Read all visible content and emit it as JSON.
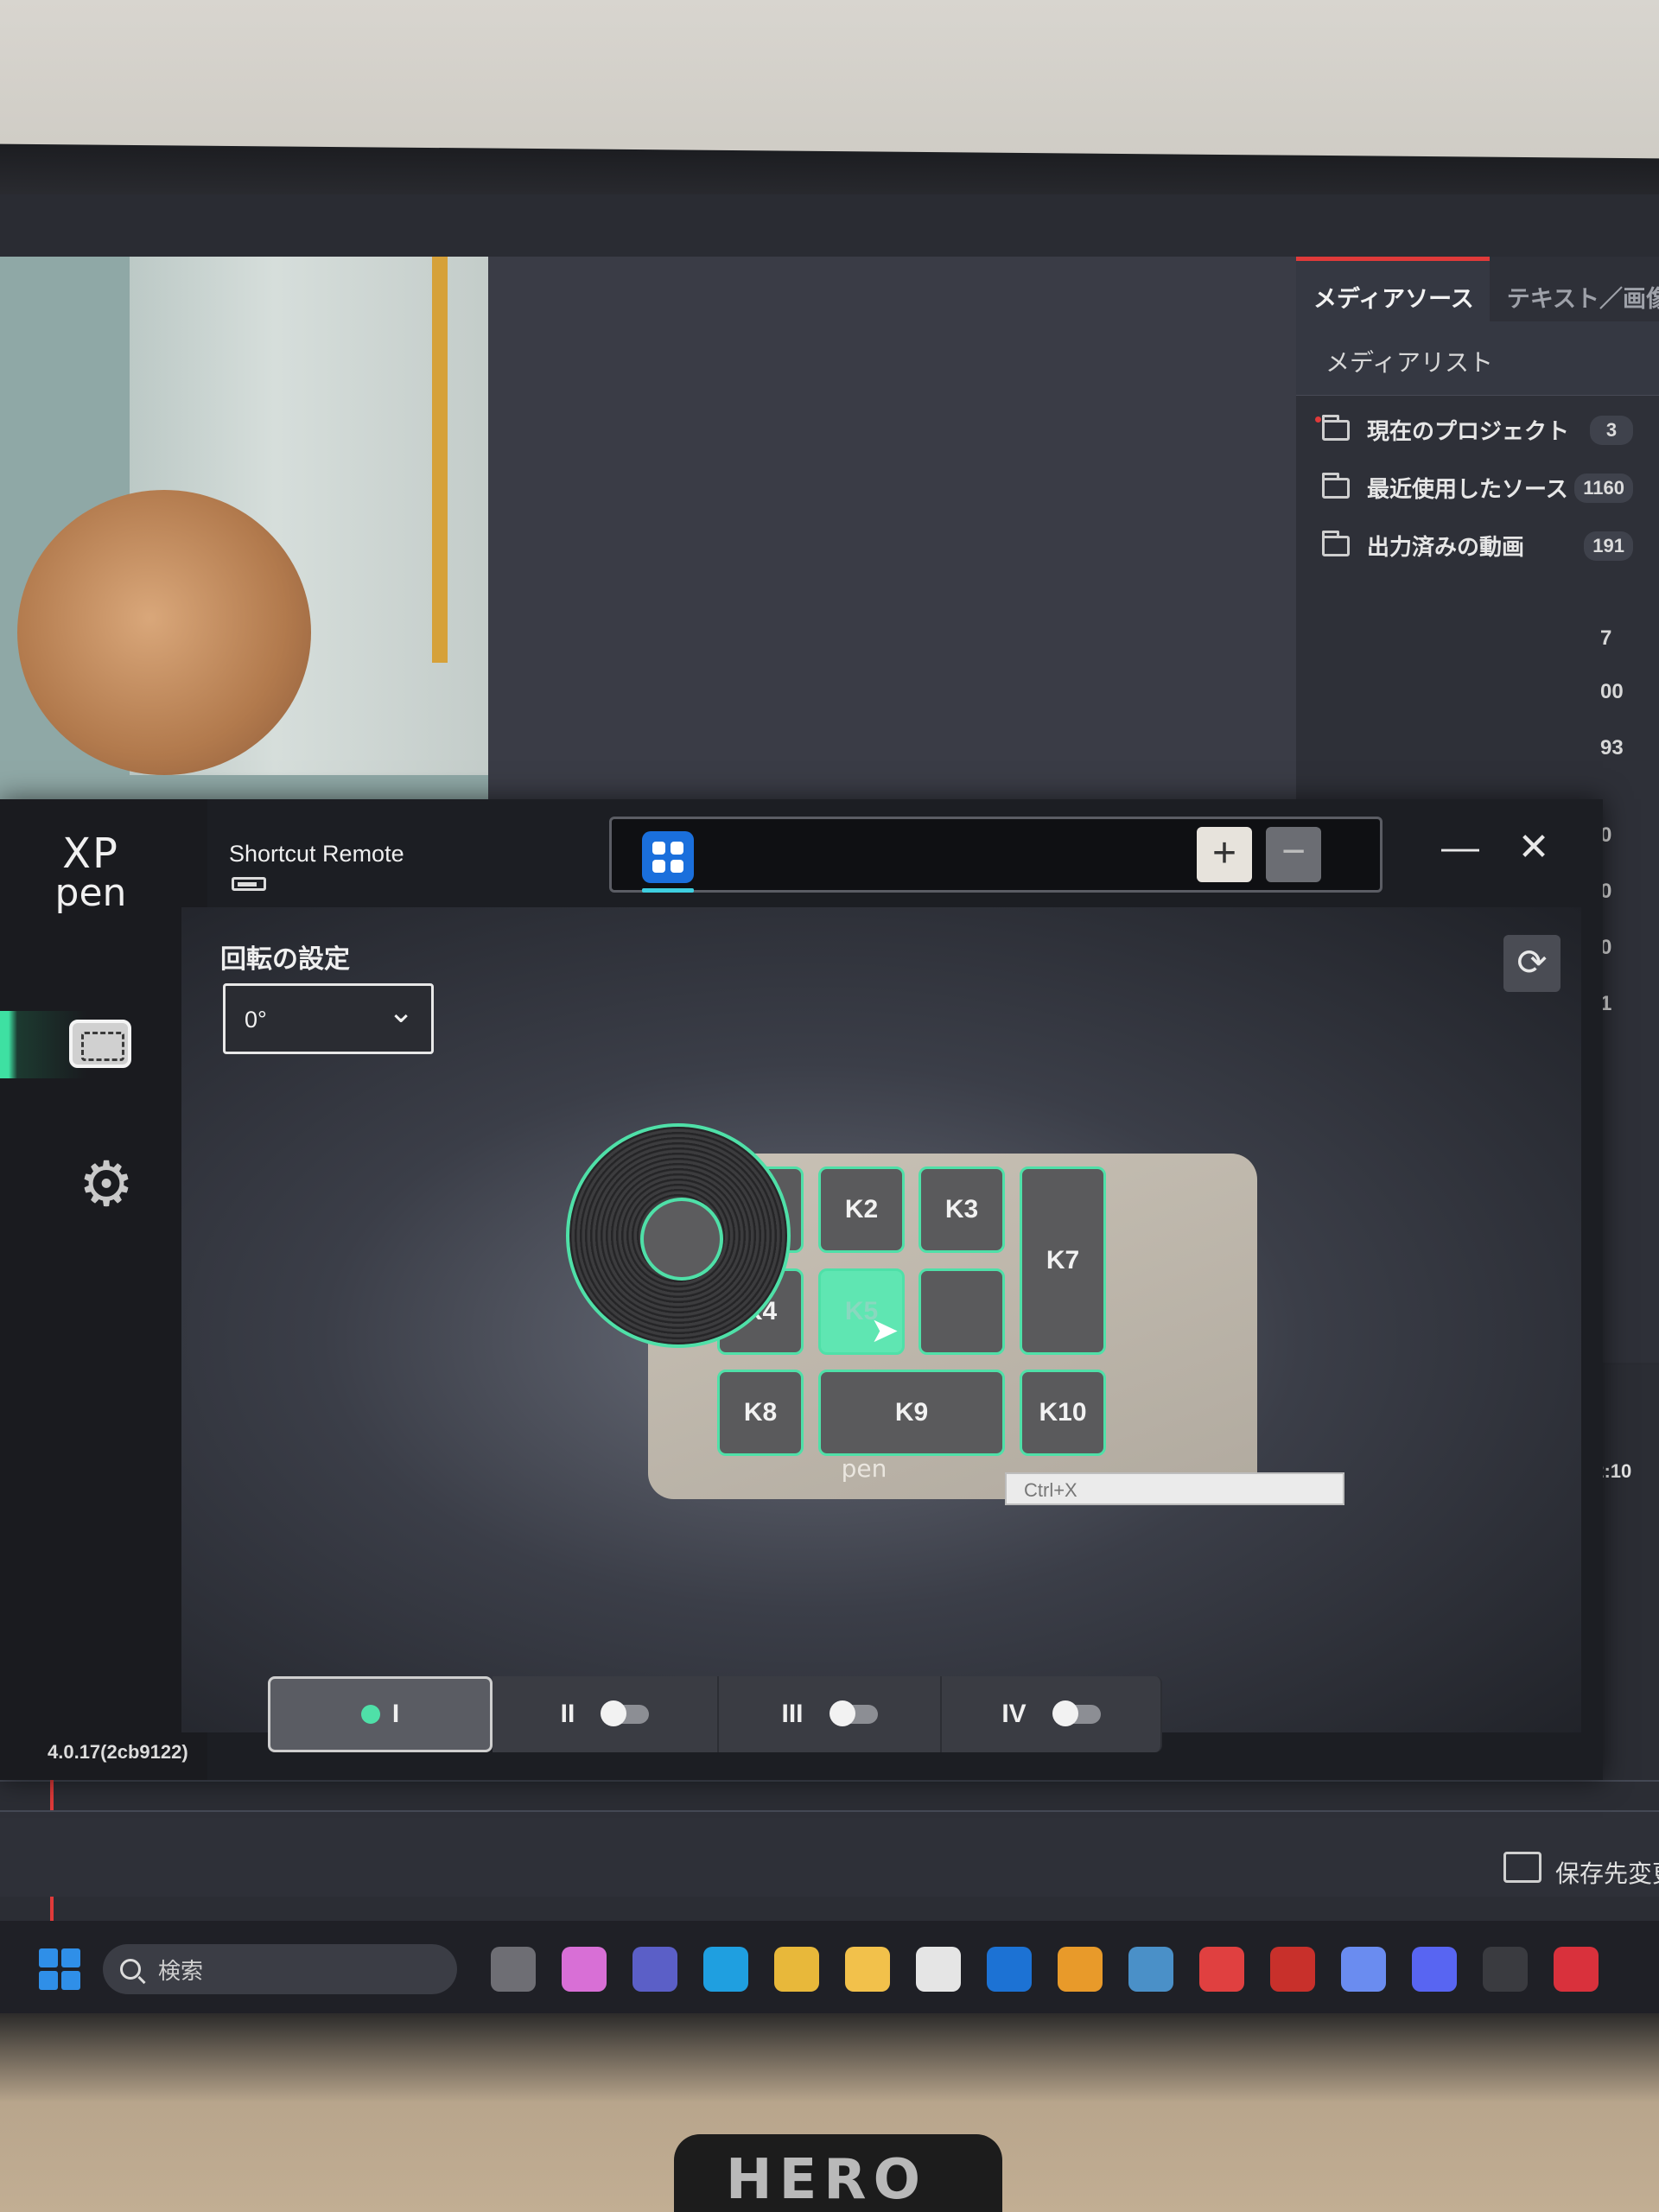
{
  "editor": {
    "tabs": [
      "メディアソース",
      "テキスト／画像"
    ],
    "media_list_title": "メディアリスト",
    "media_items": [
      {
        "label": "現在のプロジェクト",
        "count": "3"
      },
      {
        "label": "最近使用したソース",
        "count": "1160"
      },
      {
        "label": "出力済みの動画",
        "count": "191"
      }
    ],
    "peek_counts": [
      "7",
      "00",
      "93",
      "0",
      "0",
      "0",
      "1"
    ],
    "time_label": "02:10",
    "save_label": "保存先変更"
  },
  "xppen": {
    "logo": {
      "line1": "XP",
      "line2": "pen"
    },
    "device_name": "Shortcut Remote",
    "rotation_label": "回転の設定",
    "rotation_value": "0°",
    "keys": [
      "K1",
      "K2",
      "K3",
      "K7",
      "K4",
      "K5",
      "K6",
      "K8",
      "K9",
      "K10"
    ],
    "shortcut_tip": "Ctrl+X",
    "modes": [
      {
        "label": "I",
        "active": true
      },
      {
        "label": "II",
        "active": false
      },
      {
        "label": "III",
        "active": false
      },
      {
        "label": "IV",
        "active": false
      }
    ],
    "version": "4.0.17(2cb9122)"
  },
  "taskbar": {
    "search_placeholder": "検索",
    "icons": [
      "task-view-icon",
      "copilot-icon",
      "teams-icon",
      "edge-icon",
      "chrome-icon",
      "file-explorer-icon",
      "store-icon",
      "outlook-icon",
      "photos-icon",
      "amazon-photos-icon",
      "gmail-icon",
      "app-red-icon",
      "camera-app-icon",
      "discord-icon",
      "xppen-taskbar-icon",
      "snipping-icon"
    ],
    "icon_colors": [
      "#6e6e74",
      "#d86fd6",
      "#5b5fc7",
      "#1f9fe0",
      "#e8b83a",
      "#f2c14b",
      "#e5e5e5",
      "#1c72d4",
      "#e89a2a",
      "#4a90c8",
      "#e04040",
      "#c8302b",
      "#6a8cf0",
      "#5865f2",
      "#3a3b40",
      "#d9313c"
    ]
  },
  "physical": {
    "mug_text": "HERO"
  },
  "colors": {
    "accent": "#4fe0a8",
    "editor_accent": "#e03a3a",
    "app_blue": "#1a6fdc"
  }
}
